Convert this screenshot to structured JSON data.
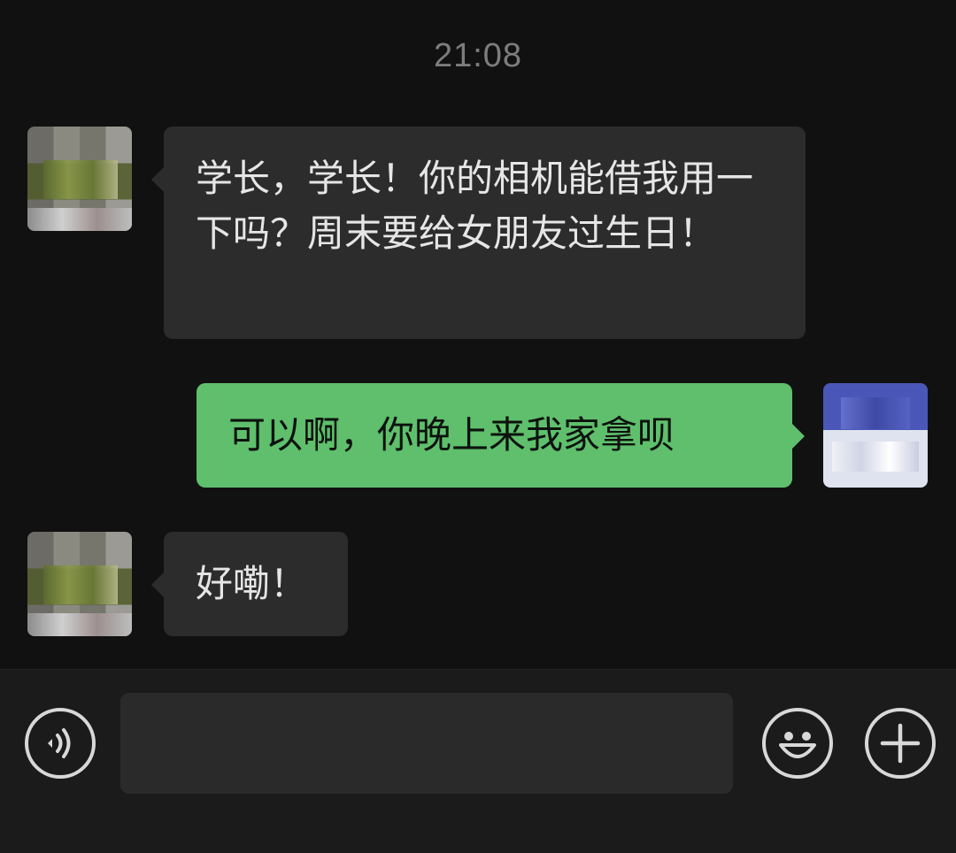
{
  "chat": {
    "timestamp": "21:08",
    "messages": [
      {
        "sender": "contact",
        "text": "学长，学长！你的相机能借我用一下吗？周末要给女朋友过生日！"
      },
      {
        "sender": "me",
        "text": "可以啊，你晚上来我家拿呗"
      },
      {
        "sender": "contact",
        "text": "好嘞！"
      }
    ]
  },
  "input_bar": {
    "message_value": "",
    "icons": [
      "voice-icon",
      "emoji-icon",
      "plus-icon"
    ]
  },
  "colors": {
    "background": "#111111",
    "incoming_bubble": "#2c2c2c",
    "outgoing_bubble": "#5fbf6c",
    "timestamp": "#7d7d7d"
  }
}
